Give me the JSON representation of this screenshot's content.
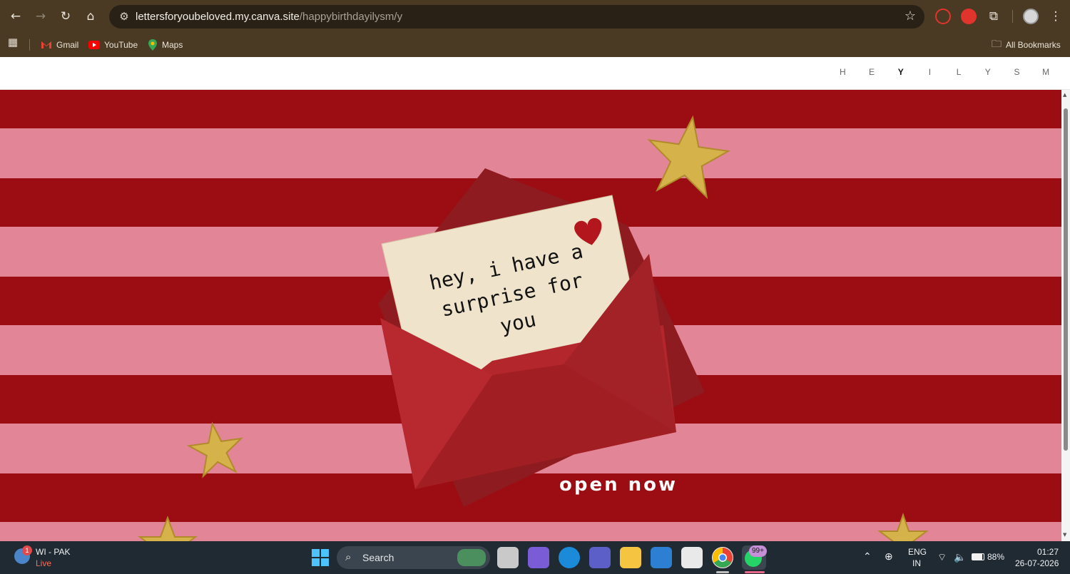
{
  "browser": {
    "url_host": "lettersforyoubeloved.my.canva.site",
    "url_path": "/happybirthdayilysm/y",
    "bookmarks": [
      "Gmail",
      "YouTube",
      "Maps"
    ],
    "all_bookmarks_label": "All Bookmarks"
  },
  "page": {
    "nav_letters": [
      "H",
      "E",
      "Y",
      "I",
      "L",
      "Y",
      "S",
      "M"
    ],
    "active_index": 2,
    "letter_text": "hey, i have a surprise for you",
    "letter_lines": [
      "hey, i have a",
      "surprise for",
      "you"
    ],
    "open_now_label": "open now"
  },
  "taskbar": {
    "weather_title": "WI - PAK",
    "weather_sub": "Live",
    "weather_badge": "1",
    "search_label": "Search",
    "whatsapp_badge": "99+",
    "lang_top": "ENG",
    "lang_bottom": "IN",
    "battery": "88%",
    "time": "01:27",
    "date": "26-07-2026"
  },
  "colors": {
    "stripe_dark": "#9b0d12",
    "stripe_light": "#e28596",
    "envelope": "#b3262b",
    "paper": "#efe3cc",
    "star": "#d6b24a"
  }
}
